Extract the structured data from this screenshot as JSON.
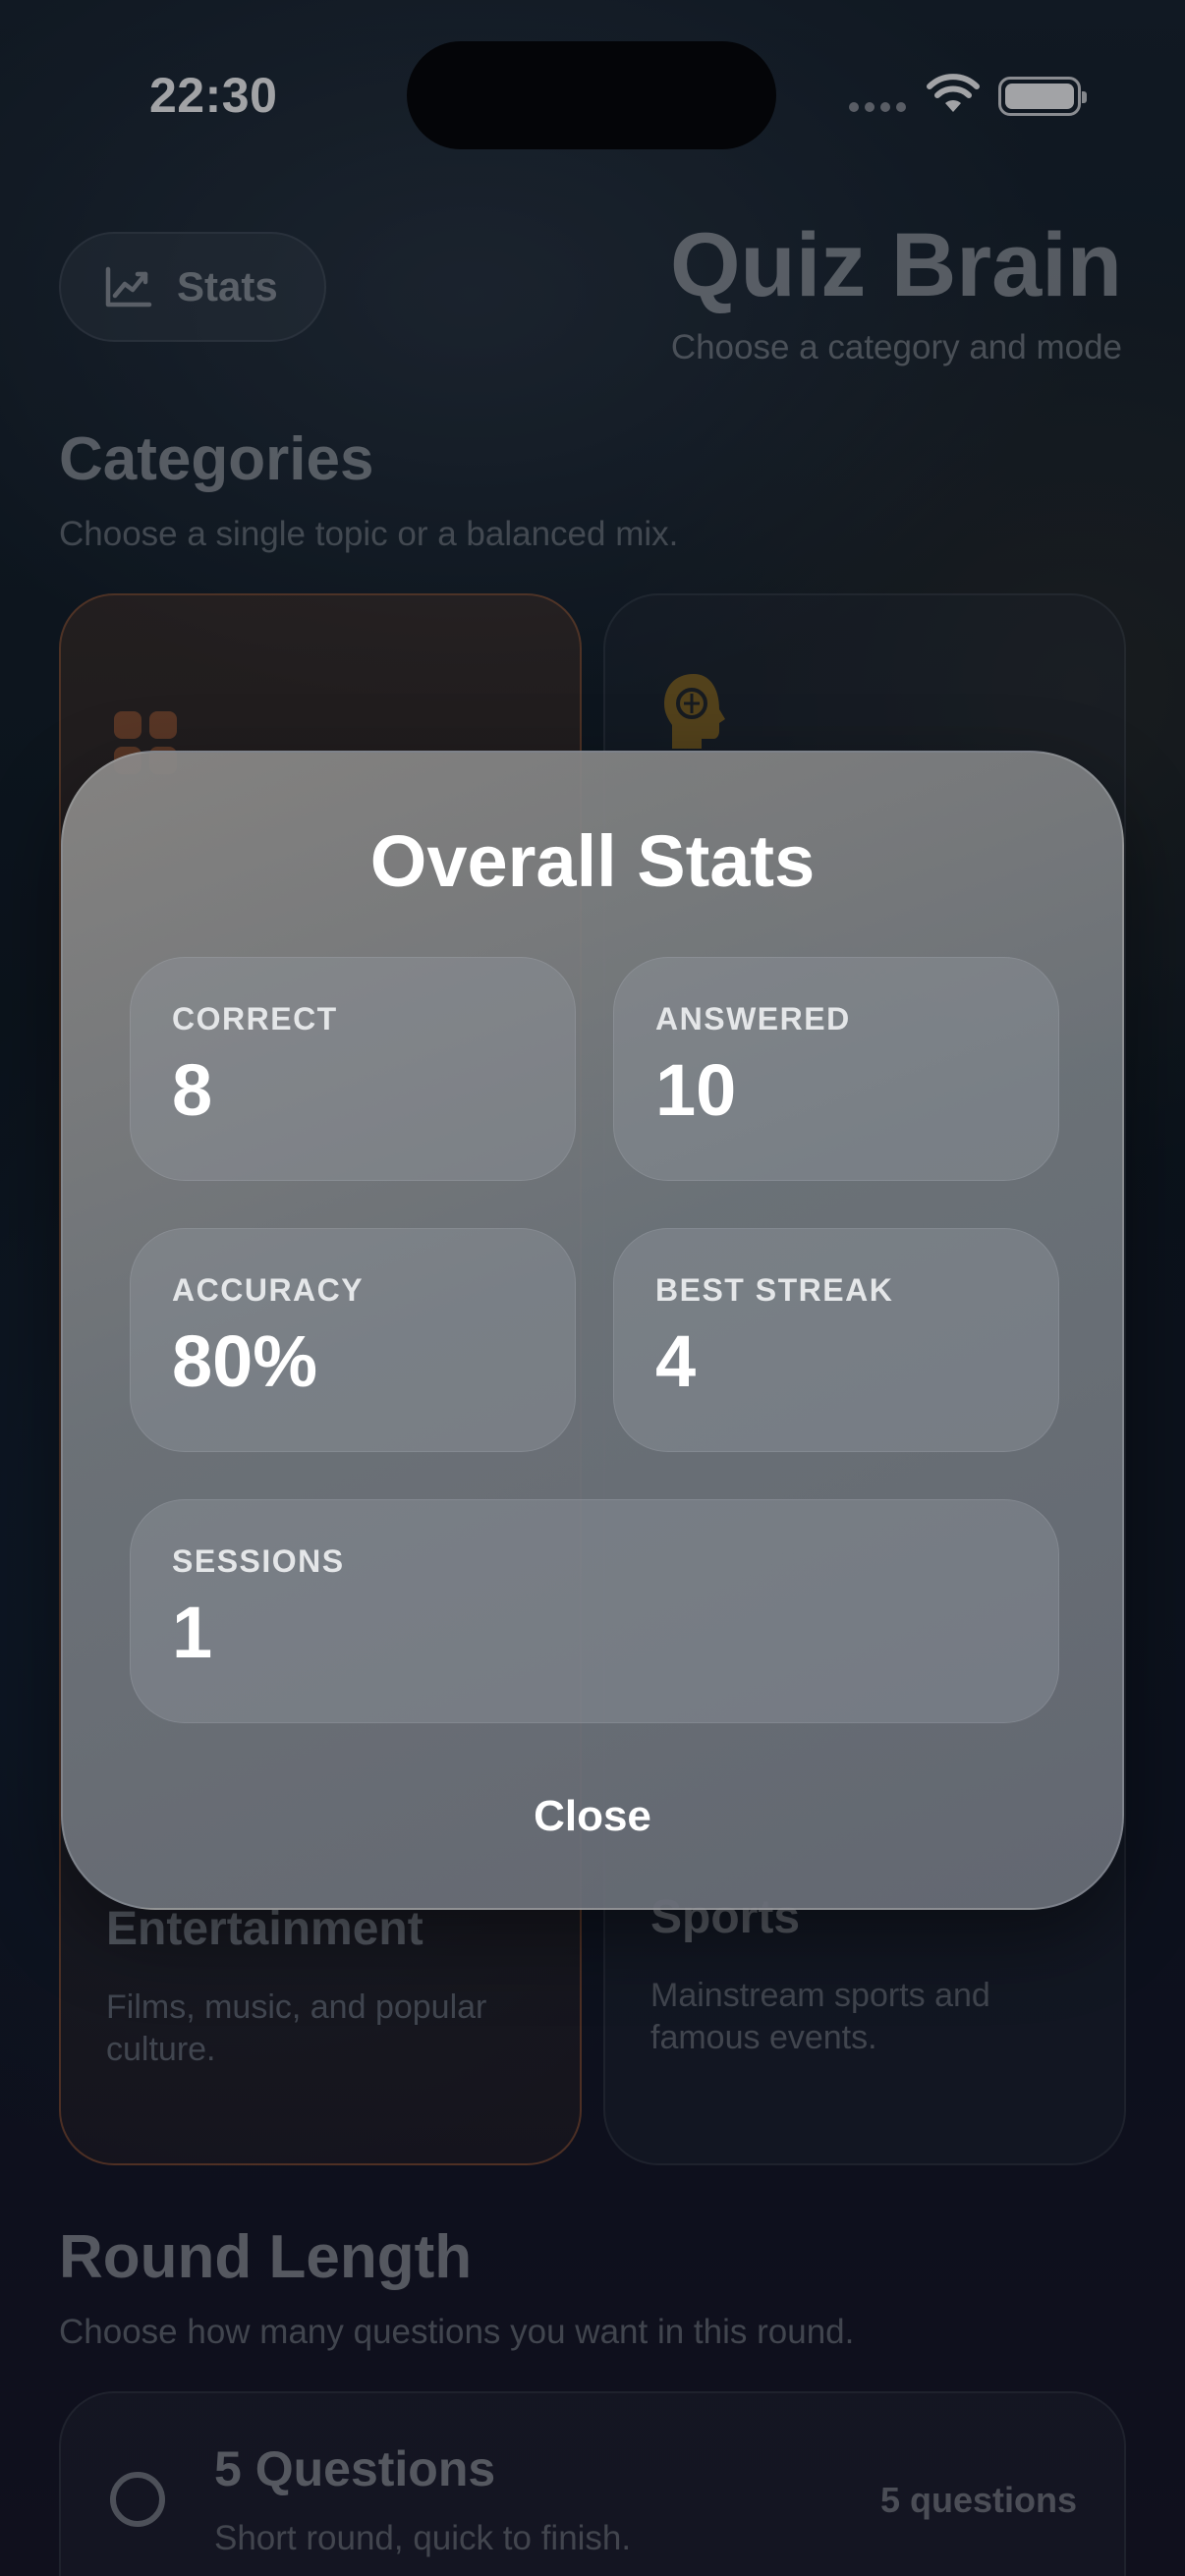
{
  "status_bar": {
    "time": "22:30"
  },
  "header": {
    "stats_button_label": "Stats",
    "title": "Quiz Brain",
    "subtitle": "Choose a category and mode"
  },
  "categories": {
    "title": "Categories",
    "subtitle": "Choose a single topic or a balanced mix.",
    "cards": [
      {
        "title": "Entertainment",
        "description": "Films, music, and popular culture.",
        "icon": "grid-icon",
        "selected": true
      },
      {
        "title": "Sports",
        "description": "Mainstream sports and famous events.",
        "icon": "brain-head-icon",
        "selected": false
      }
    ]
  },
  "round_length": {
    "title": "Round Length",
    "subtitle": "Choose how many questions you want in this round.",
    "options": [
      {
        "title": "5 Questions",
        "subtitle": "Short round, quick to finish.",
        "count": "5 questions"
      }
    ]
  },
  "modal": {
    "title": "Overall Stats",
    "tiles": [
      {
        "label": "CORRECT",
        "value": "8"
      },
      {
        "label": "ANSWERED",
        "value": "10"
      },
      {
        "label": "ACCURACY",
        "value": "80%"
      },
      {
        "label": "BEST STREAK",
        "value": "4"
      },
      {
        "label": "SESSIONS",
        "value": "1"
      }
    ],
    "close_label": "Close"
  },
  "colors": {
    "accent_orange": "#d9743a",
    "brain_icon": "#c7901e",
    "modal_bg": "#7a7f86"
  }
}
